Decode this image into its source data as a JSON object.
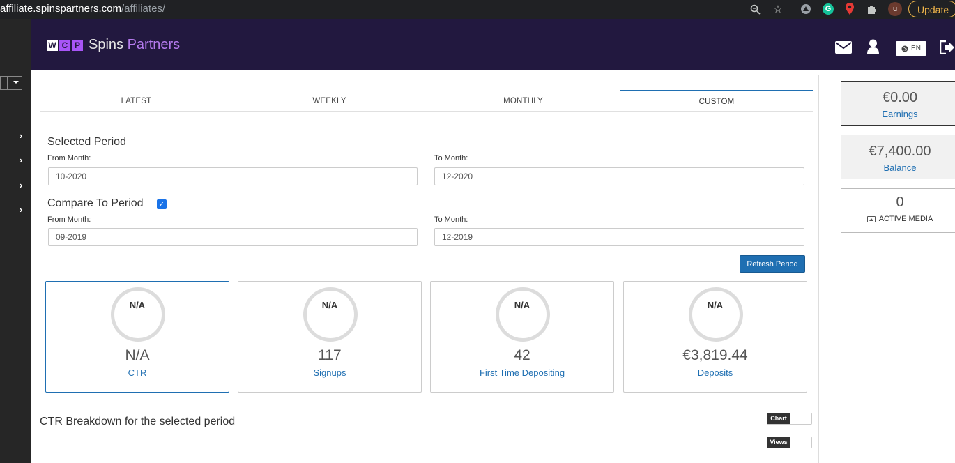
{
  "browser": {
    "url_host": "affiliate.spinspartners.com",
    "url_path": "/affiliates/",
    "avatar_letter": "u",
    "update_label": "Update"
  },
  "header": {
    "logo_mark": [
      "W",
      "C",
      "P"
    ],
    "brand_word1": "Spins",
    "brand_word2": "Partners",
    "lang_label": "EN"
  },
  "tabs": [
    {
      "label": "LATEST"
    },
    {
      "label": "WEEKLY"
    },
    {
      "label": "MONTHLY"
    },
    {
      "label": "CUSTOM",
      "active": true
    }
  ],
  "selected_period": {
    "title": "Selected Period",
    "from_label": "From Month:",
    "from_value": "10-2020",
    "to_label": "To Month:",
    "to_value": "12-2020"
  },
  "compare_period": {
    "title": "Compare To Period",
    "checked": true,
    "from_label": "From Month:",
    "from_value": "09-2019",
    "to_label": "To Month:",
    "to_value": "12-2019"
  },
  "refresh_label": "Refresh Period",
  "stats": [
    {
      "ring": "N/A",
      "value": "N/A",
      "label": "CTR"
    },
    {
      "ring": "N/A",
      "value": "117",
      "label": "Signups"
    },
    {
      "ring": "N/A",
      "value": "42",
      "label": "First Time Depositing"
    },
    {
      "ring": "N/A",
      "value": "€3,819.44",
      "label": "Deposits"
    }
  ],
  "breakdown_title": "CTR Breakdown for the selected period",
  "toggles": [
    {
      "label": "Chart"
    },
    {
      "label": "Views"
    }
  ],
  "summary": {
    "earnings_value": "€0.00",
    "earnings_label": "Earnings",
    "balance_value": "€7,400.00",
    "balance_label": "Balance",
    "media_value": "0",
    "media_label": "ACTIVE MEDIA"
  },
  "colors": {
    "header_bg": "#22183f",
    "accent": "#1f6fb2",
    "brand_purple": "#b57bee"
  }
}
